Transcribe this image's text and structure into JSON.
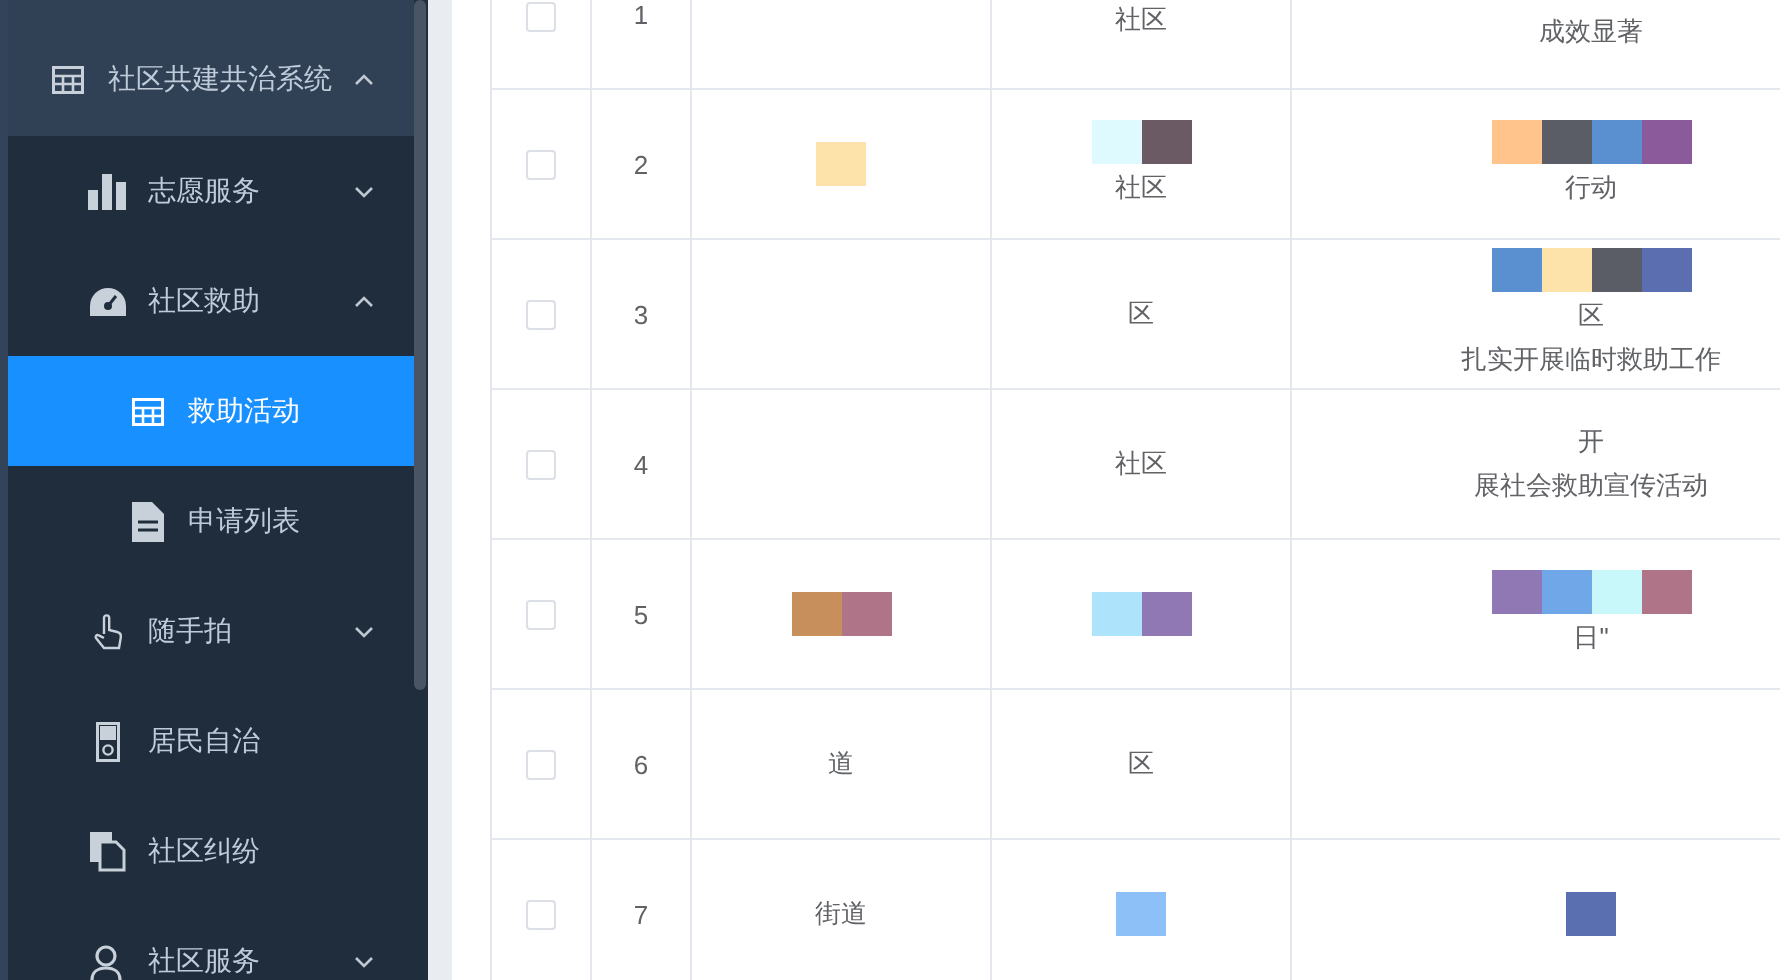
{
  "sidebar": {
    "items": [
      {
        "label": "社区共建共治系统",
        "kind": "group",
        "expanded": true,
        "children": [
          {
            "label": "志愿服务",
            "kind": "group",
            "expanded": false
          },
          {
            "label": "社区救助",
            "kind": "group",
            "expanded": true,
            "children": [
              {
                "label": "救助活动",
                "kind": "link",
                "selected": true
              },
              {
                "label": "申请列表",
                "kind": "link",
                "selected": false
              }
            ]
          },
          {
            "label": "随手拍",
            "kind": "group",
            "expanded": false
          },
          {
            "label": "居民自治",
            "kind": "link",
            "selected": false
          },
          {
            "label": "社区纠纷",
            "kind": "link",
            "selected": false
          },
          {
            "label": "社区服务",
            "kind": "group",
            "expanded": false
          }
        ]
      }
    ]
  },
  "table": {
    "rows": [
      {
        "checked": false,
        "index": "1",
        "cells": [
          {},
          {
            "lines": [
              "社区"
            ]
          },
          {
            "lines": [
              "成效显著"
            ]
          }
        ]
      },
      {
        "checked": false,
        "index": "2",
        "cells": [
          {
            "redacted": true
          },
          {
            "lines": [
              "社区"
            ],
            "redacted": true
          },
          {
            "lines": [
              "行动"
            ],
            "redacted": true
          }
        ]
      },
      {
        "checked": false,
        "index": "3",
        "cells": [
          {},
          {
            "lines": [
              "区"
            ]
          },
          {
            "lines": [
              "区",
              "扎实开展临时救助工作"
            ],
            "redacted": true
          }
        ]
      },
      {
        "checked": false,
        "index": "4",
        "cells": [
          {},
          {
            "lines": [
              "社区"
            ]
          },
          {
            "lines": [
              "开",
              "展社会救助宣传活动"
            ]
          }
        ]
      },
      {
        "checked": false,
        "index": "5",
        "cells": [
          {
            "redacted": true
          },
          {
            "redacted": true
          },
          {
            "lines": [
              "日\""
            ],
            "redacted": true
          }
        ]
      },
      {
        "checked": false,
        "index": "6",
        "cells": [
          {
            "lines": [
              "道"
            ]
          },
          {
            "lines": [
              "区"
            ]
          },
          {}
        ]
      },
      {
        "checked": false,
        "index": "7",
        "cells": [
          {
            "lines": [
              "街道"
            ]
          },
          {
            "redacted": true
          },
          {
            "redacted": true
          }
        ]
      }
    ]
  }
}
